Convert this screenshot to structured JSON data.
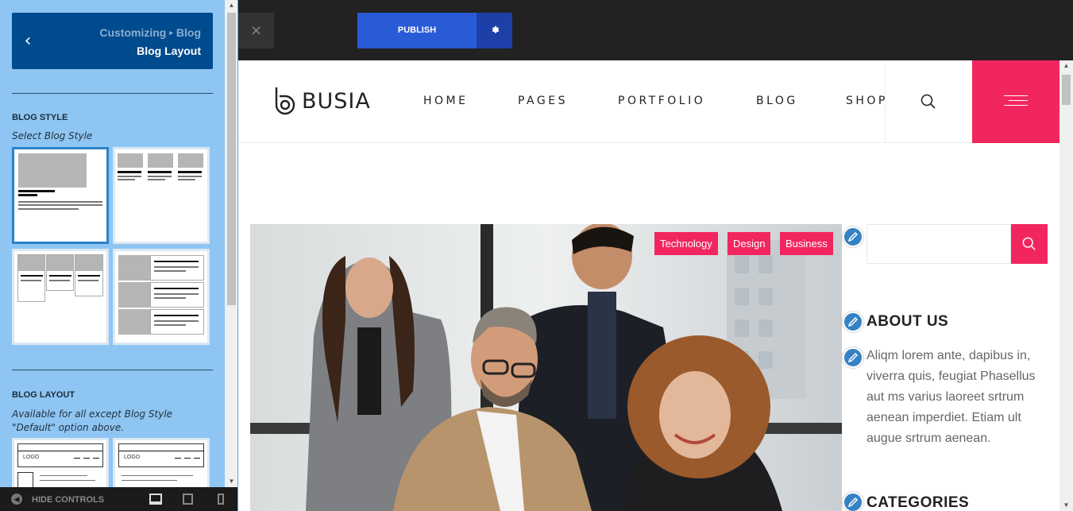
{
  "customizer": {
    "breadcrumb_parent": "Customizing",
    "breadcrumb_child": "Blog",
    "title": "Blog Layout",
    "blog_style": {
      "heading": "BLOG STYLE",
      "description": "Select Blog Style"
    },
    "blog_layout": {
      "heading": "BLOG LAYOUT",
      "description": "Available for all except Blog Style \"Default\" option above.",
      "thumb_logo": "LOGO"
    },
    "footer": {
      "hide_controls": "HIDE CONTROLS"
    }
  },
  "topbar": {
    "close": "×",
    "publish": "PUBLISH"
  },
  "site": {
    "logo": "BUSIA",
    "nav": [
      "HOME",
      "PAGES",
      "PORTFOLIO",
      "BLOG",
      "SHOP"
    ],
    "tags": [
      "Technology",
      "Design",
      "Business"
    ],
    "sidebar": {
      "about_title": "ABOUT US",
      "about_text": "Aliqm lorem ante, dapibus in, viverra quis, feugiat Phasellus aut ms varius laoreet srtrum aenean imperdiet. Etiam ult augue srtrum aenean.",
      "categories_title": "CATEGORIES"
    }
  },
  "colors": {
    "accent": "#f2265f",
    "customizer_bg": "#8ec5f2",
    "customizer_header": "#004b8d",
    "publish": "#2a5bd7"
  }
}
